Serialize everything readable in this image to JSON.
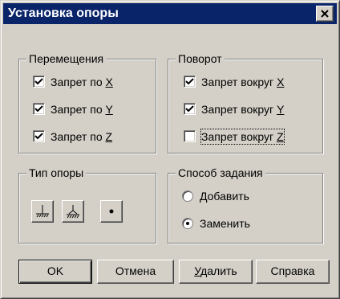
{
  "window": {
    "title": "Установка опоры",
    "close_label": "close"
  },
  "movement": {
    "legend": "Перемещения",
    "items": [
      {
        "prefix": "Запрет по ",
        "axis": "X",
        "checked": true
      },
      {
        "prefix": "Запрет по ",
        "axis": "Y",
        "checked": true
      },
      {
        "prefix": "Запрет по ",
        "axis": "Z",
        "checked": true
      }
    ]
  },
  "rotation": {
    "legend": "Поворот",
    "items": [
      {
        "prefix": "Запрет вокруг ",
        "axis": "X",
        "checked": true
      },
      {
        "prefix": "Запрет вокруг ",
        "axis": "Y",
        "checked": true
      },
      {
        "prefix": "Запрет вокруг ",
        "axis": "Z",
        "checked": false
      }
    ]
  },
  "support_type": {
    "legend": "Тип опоры",
    "buttons": [
      "fixed-support-icon",
      "pinned-support-icon",
      "free-node-icon"
    ]
  },
  "method": {
    "legend": "Способ задания",
    "options": [
      {
        "label": "Добавить",
        "selected": false
      },
      {
        "label": "Заменить",
        "selected": true
      }
    ]
  },
  "buttons": {
    "ok": "OK",
    "cancel": "Отмена",
    "delete_ul": "У",
    "delete_rest": "далить",
    "help": "Справка"
  }
}
